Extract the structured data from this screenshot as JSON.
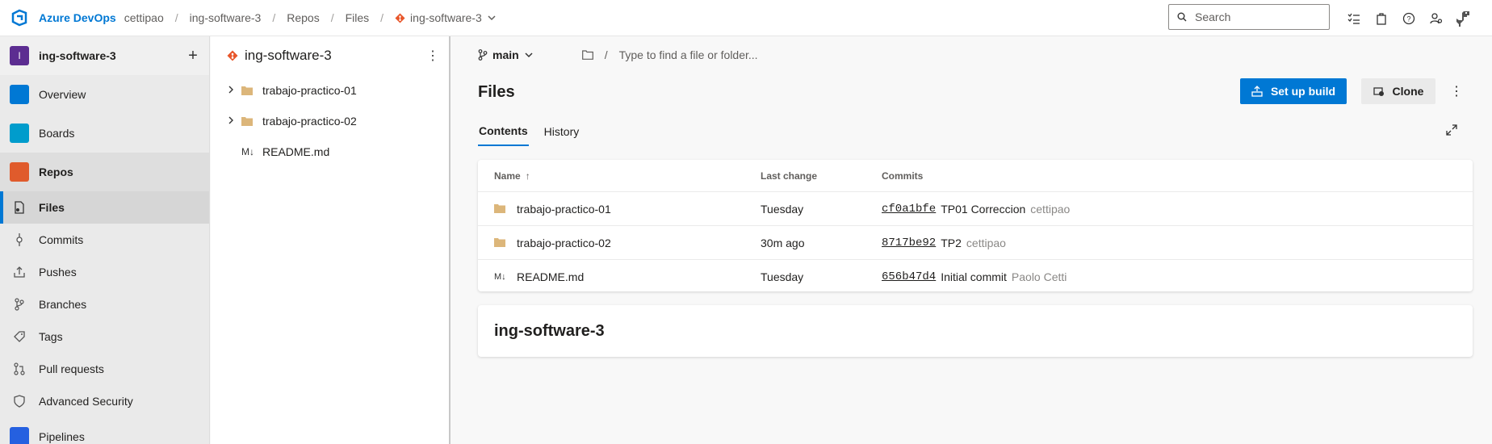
{
  "topbar": {
    "brand": "Azure DevOps",
    "breadcrumb": [
      "cettipao",
      "ing-software-3",
      "Repos",
      "Files"
    ],
    "repo_crumb": "ing-software-3",
    "search_placeholder": "Search"
  },
  "project": {
    "initial": "I",
    "name": "ing-software-3"
  },
  "nav": {
    "overview": "Overview",
    "boards": "Boards",
    "repos": "Repos",
    "sub": [
      "Files",
      "Commits",
      "Pushes",
      "Branches",
      "Tags",
      "Pull requests",
      "Advanced Security"
    ],
    "pipelines": "Pipelines"
  },
  "tree": {
    "title": "ing-software-3",
    "items": [
      "trabajo-practico-01",
      "trabajo-practico-02",
      "README.md"
    ]
  },
  "main": {
    "branch": "main",
    "path_placeholder": "Type to find a file or folder...",
    "title": "Files",
    "build_button": "Set up build",
    "clone_button": "Clone",
    "tabs": [
      "Contents",
      "History"
    ],
    "columns": [
      "Name",
      "Last change",
      "Commits"
    ],
    "rows": [
      {
        "name": "trabajo-practico-01",
        "last": "Tuesday",
        "hash": "cf0a1bfe",
        "msg": "TP01 Correccion",
        "author": "cettipao"
      },
      {
        "name": "trabajo-practico-02",
        "last": "30m ago",
        "hash": "8717be92",
        "msg": "TP2",
        "author": "cettipao"
      },
      {
        "name": "README.md",
        "last": "Tuesday",
        "hash": "656b47d4",
        "msg": "Initial commit",
        "author": "Paolo Cetti"
      }
    ],
    "readme_title": "ing-software-3"
  },
  "colors": {
    "accent": "#0078d4",
    "project_badge": "#5c2d91",
    "folder": "#dcb67a"
  }
}
